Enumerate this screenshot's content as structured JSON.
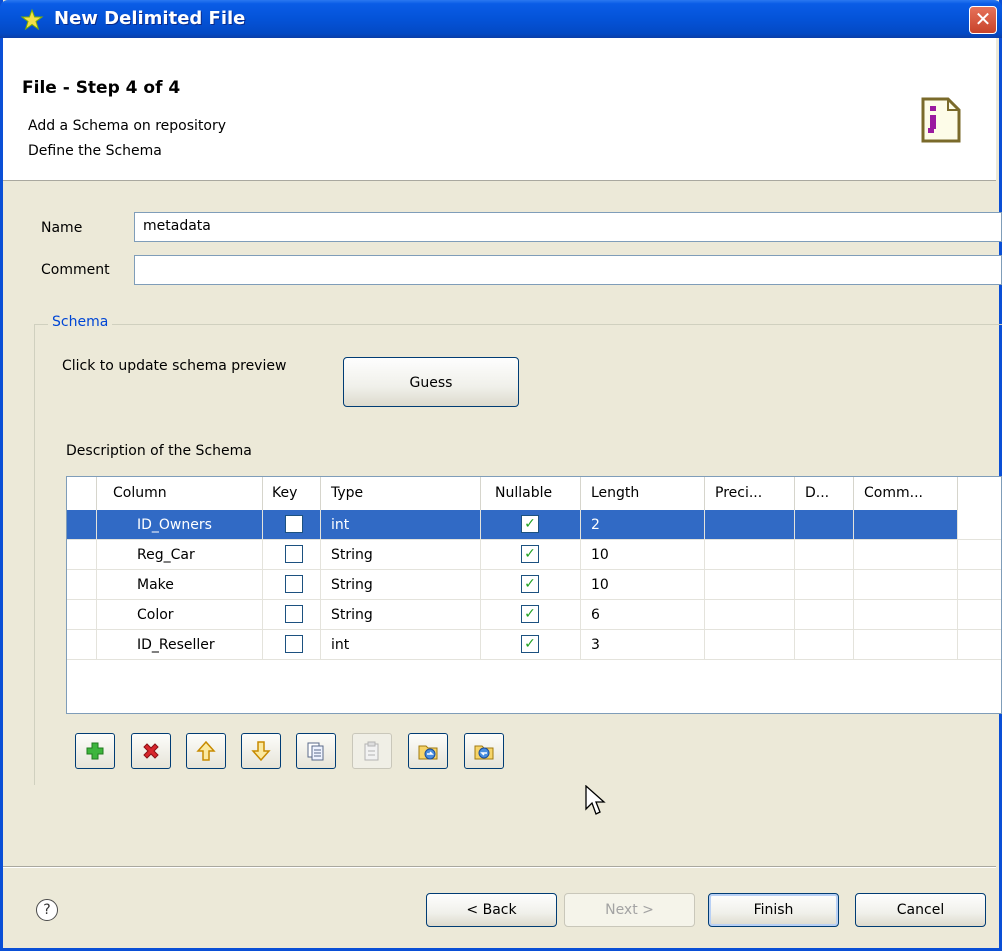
{
  "window": {
    "title": "New Delimited File"
  },
  "header": {
    "step_title": "File - Step 4 of 4",
    "desc_line1": "Add a Schema on repository",
    "desc_line2": "Define the Schema"
  },
  "form": {
    "name_label": "Name",
    "name_value": "metadata",
    "comment_label": "Comment",
    "comment_value": ""
  },
  "schema": {
    "group_label": "Schema",
    "preview_label": "Click to update schema preview",
    "guess_button": "Guess",
    "description_label": "Description of the Schema",
    "columns": [
      "Column",
      "Key",
      "Type",
      "Nullable",
      "Length",
      "Preci...",
      "D...",
      "Comm..."
    ],
    "rows": [
      {
        "column": "ID_Owners",
        "key": false,
        "type": "int",
        "nullable": true,
        "length": "2"
      },
      {
        "column": "Reg_Car",
        "key": false,
        "type": "String",
        "nullable": true,
        "length": "10"
      },
      {
        "column": "Make",
        "key": false,
        "type": "String",
        "nullable": true,
        "length": "10"
      },
      {
        "column": "Color",
        "key": false,
        "type": "String",
        "nullable": true,
        "length": "6"
      },
      {
        "column": "ID_Reseller",
        "key": false,
        "type": "int",
        "nullable": true,
        "length": "3"
      }
    ],
    "toolbar_icons": [
      "add-icon",
      "delete-icon",
      "move-up-icon",
      "move-down-icon",
      "copy-icon",
      "paste-icon",
      "import-icon",
      "export-icon"
    ]
  },
  "footer": {
    "back": "< Back",
    "next": "Next >",
    "finish": "Finish",
    "cancel": "Cancel"
  },
  "colors": {
    "titlebar": "#0453d8",
    "selection": "#316ac5",
    "group_label": "#0046d5"
  }
}
